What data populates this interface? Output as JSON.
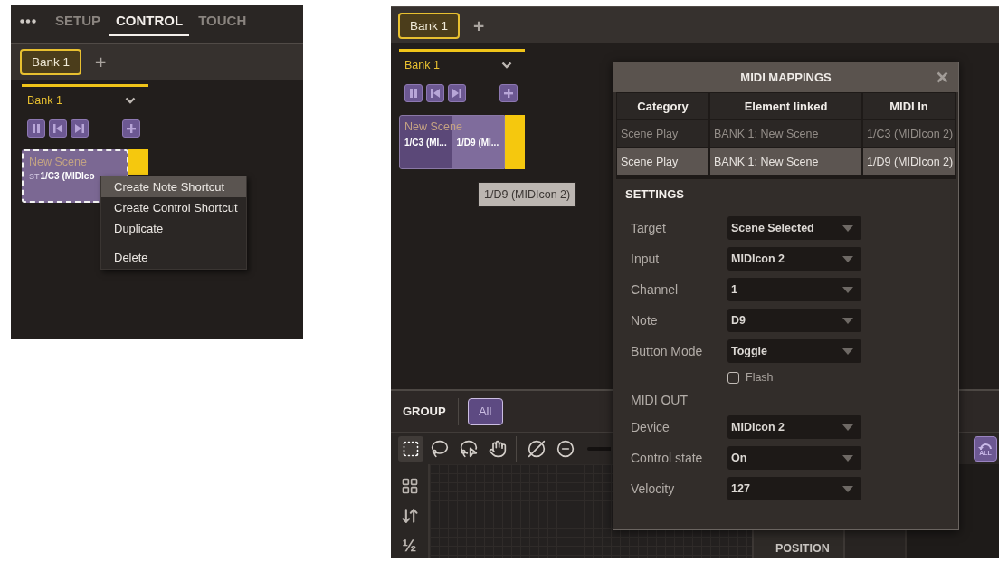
{
  "left_view": {
    "mode_tabs": [
      {
        "label": "SETUP",
        "selected": false
      },
      {
        "label": "CONTROL",
        "selected": true
      },
      {
        "label": "TOUCH",
        "selected": false
      }
    ],
    "bank_tabs": [
      {
        "label": "Bank 1",
        "selected": true
      }
    ],
    "add_bank_label": "+",
    "bank_title": "Bank 1",
    "scene": {
      "name": "New Scene",
      "status": "ST",
      "shortcut": "1/C3 (MIDIco",
      "selected": true
    },
    "context_menu": [
      {
        "label": "Create Note Shortcut",
        "selected": true,
        "separator_before": false
      },
      {
        "label": "Create Control Shortcut",
        "selected": false,
        "separator_before": false
      },
      {
        "label": "Duplicate",
        "selected": false,
        "separator_before": false
      },
      {
        "label": "Delete",
        "selected": false,
        "separator_before": true
      }
    ]
  },
  "right_view": {
    "bank_tabs": [
      {
        "label": "Bank 1",
        "selected": true
      }
    ],
    "add_bank_label": "+",
    "bank_title": "Bank 1",
    "scene": {
      "name": "New Scene",
      "selected": false,
      "shortcuts": [
        {
          "label": "1/C3 (MI...",
          "selected": false
        },
        {
          "label": "1/D9 (MI...",
          "selected": true
        }
      ]
    },
    "tooltip": "1/D9 (MIDIcon 2)",
    "group_bar": {
      "title": "GROUP",
      "filters": [
        {
          "label": "All",
          "selected": true
        }
      ]
    },
    "toolbar": {
      "tools": [
        {
          "selected": true
        },
        {
          "selected": false
        },
        {
          "selected": false
        },
        {
          "selected": false
        }
      ],
      "reset_label": "ALL"
    },
    "side_glyph": "½",
    "properties": [
      "POSITION"
    ],
    "dialog": {
      "title": "MIDI MAPPINGS",
      "table": {
        "columns": [
          "Category",
          "Element linked",
          "MIDI In"
        ],
        "rows": [
          {
            "cells": [
              "Scene Play",
              "BANK 1: New Scene",
              "1/C3 (MIDIcon 2)"
            ],
            "selected": false
          },
          {
            "cells": [
              "Scene Play",
              "BANK 1: New Scene",
              "1/D9 (MIDIcon 2)"
            ],
            "selected": true
          }
        ]
      },
      "settings_title": "SETTINGS",
      "fields": [
        {
          "kind": "select",
          "label": "Target",
          "value": "Scene Selected"
        },
        {
          "kind": "select",
          "label": "Input",
          "value": "MIDIcon 2"
        },
        {
          "kind": "select",
          "label": "Channel",
          "value": "1"
        },
        {
          "kind": "select",
          "label": "Note",
          "value": "D9"
        },
        {
          "kind": "select",
          "label": "Button Mode",
          "value": "Toggle"
        },
        {
          "kind": "checkbox",
          "label": "Flash",
          "checked": false
        },
        {
          "kind": "heading",
          "label": "MIDI OUT"
        },
        {
          "kind": "select",
          "label": "Device",
          "value": "MIDIcon 2"
        },
        {
          "kind": "select",
          "label": "Control state",
          "value": "On"
        },
        {
          "kind": "select",
          "label": "Velocity",
          "value": "127"
        }
      ]
    }
  }
}
